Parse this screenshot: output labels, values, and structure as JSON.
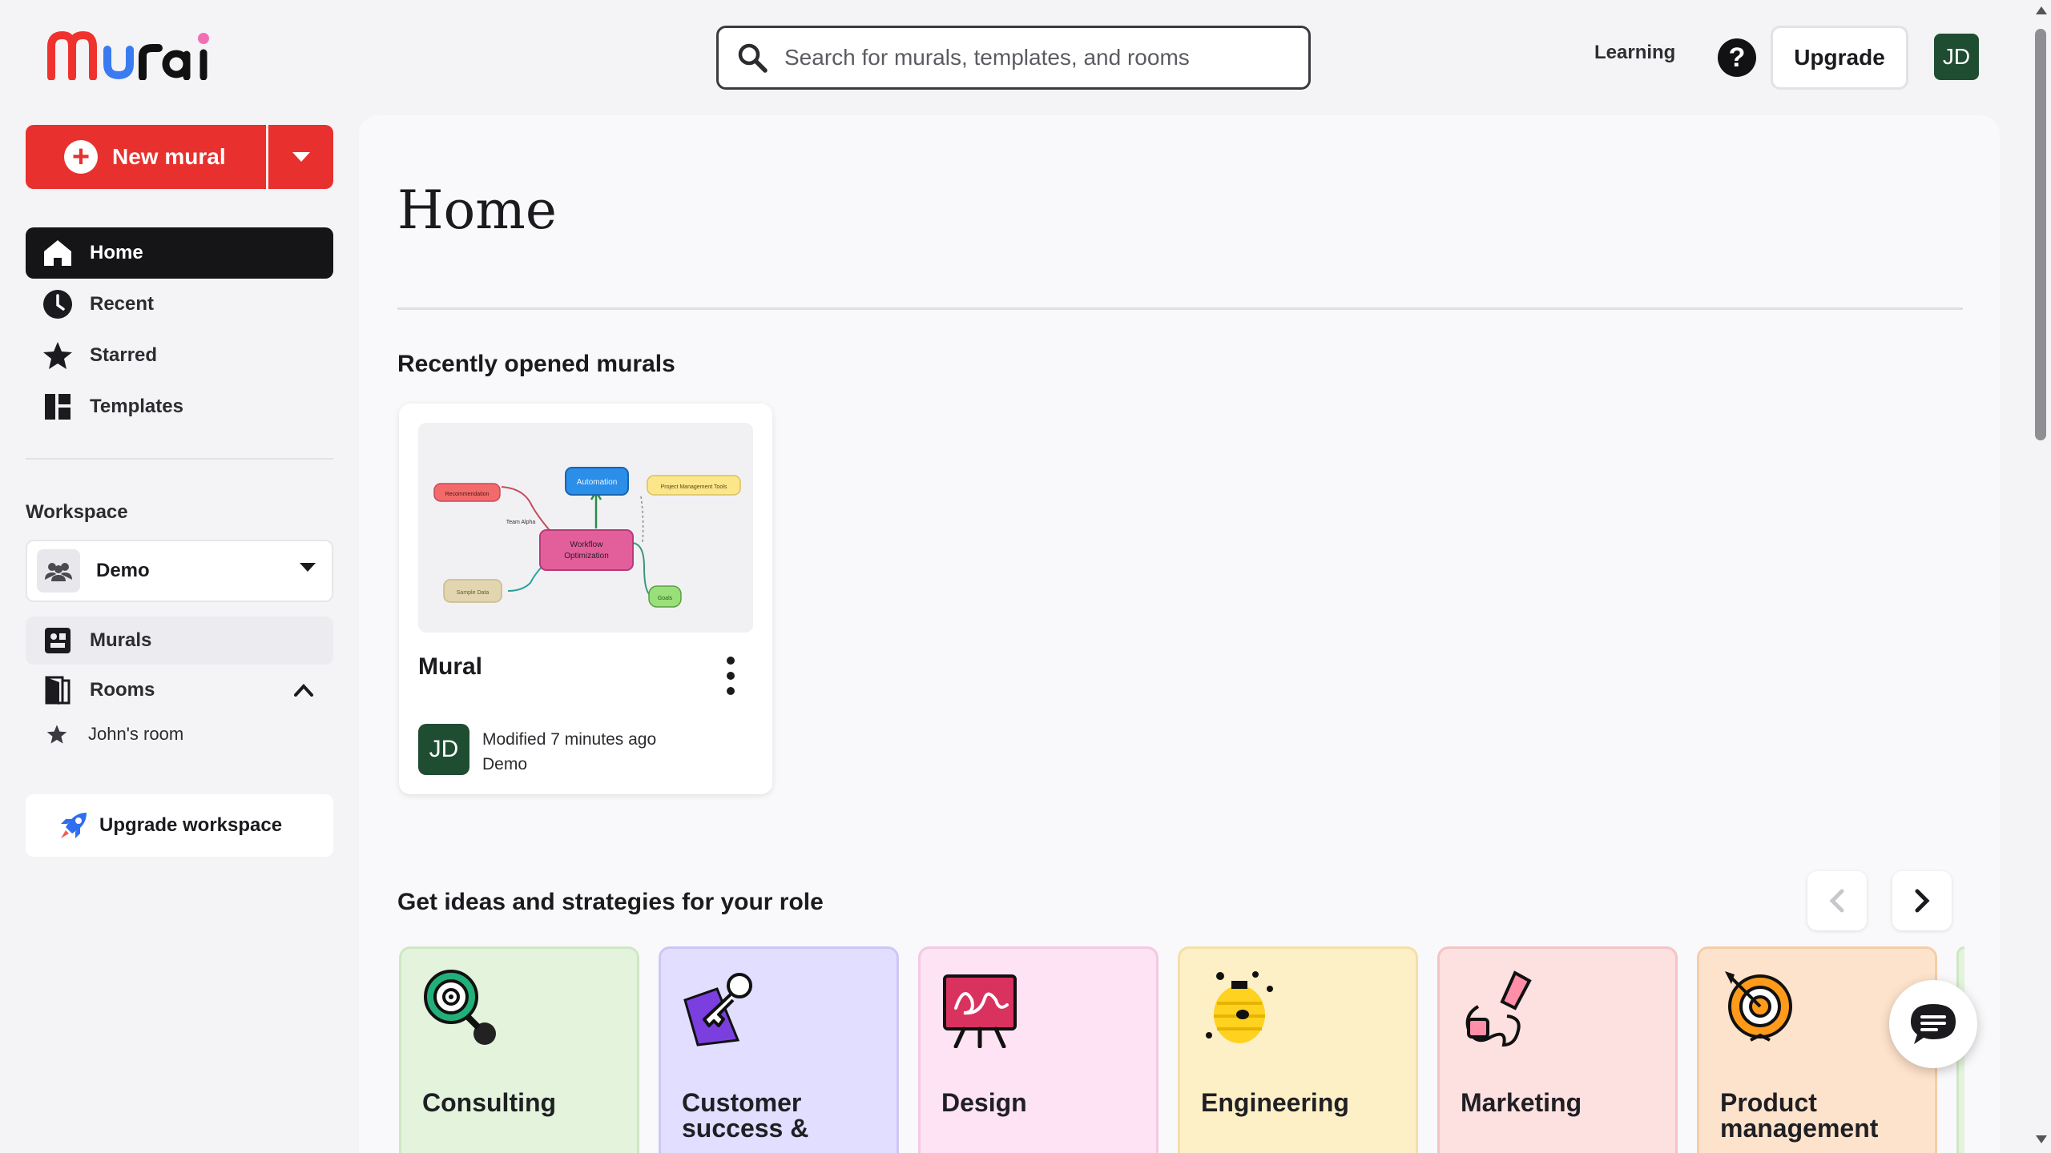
{
  "app": {
    "logo_text": "Mural"
  },
  "search": {
    "placeholder": "Search for murals, templates, and rooms"
  },
  "header": {
    "learning": "Learning",
    "help": "?",
    "upgrade": "Upgrade",
    "avatar": "JD"
  },
  "sidebar": {
    "new_mural": "New mural",
    "nav": [
      {
        "label": "Home",
        "icon": "home-icon",
        "active": true
      },
      {
        "label": "Recent",
        "icon": "clock-icon"
      },
      {
        "label": "Starred",
        "icon": "star-icon"
      },
      {
        "label": "Templates",
        "icon": "templates-icon"
      }
    ],
    "workspace_label": "Workspace",
    "workspace_name": "Demo",
    "murals": "Murals",
    "rooms": "Rooms",
    "room_item": "John's room",
    "upgrade_workspace": "Upgrade workspace"
  },
  "main": {
    "title": "Home",
    "recent_title": "Recently opened murals",
    "mural_card": {
      "name": "Mural",
      "avatar": "JD",
      "modified": "Modified 7 minutes ago",
      "workspace": "Demo",
      "thumbnail": {
        "center": "Workflow Optimization",
        "automation": "Automation",
        "tools": "Project Management Tools",
        "recommendation": "Recommendation",
        "team": "Team Alpha",
        "sample": "Sample Data",
        "goals": "Goals"
      }
    },
    "ideas_title": "Get ideas and strategies for your role",
    "roles": [
      {
        "label": "Consulting",
        "bg": "#e3f3dc",
        "border": "#cfe7c4"
      },
      {
        "label": "Customer success &",
        "bg": "#e2deff",
        "border": "#cdc6f7"
      },
      {
        "label": "Design",
        "bg": "#fde3f3",
        "border": "#f5c8e4"
      },
      {
        "label": "Engineering",
        "bg": "#fdf0c6",
        "border": "#f2e0a6"
      },
      {
        "label": "Marketing",
        "bg": "#fde0e0",
        "border": "#f4c4c4"
      },
      {
        "label": "Product management",
        "bg": "#fee3cc",
        "border": "#f5cda9"
      }
    ]
  },
  "colors": {
    "brand_red": "#e8302e",
    "avatar_green": "#1f4d32"
  }
}
